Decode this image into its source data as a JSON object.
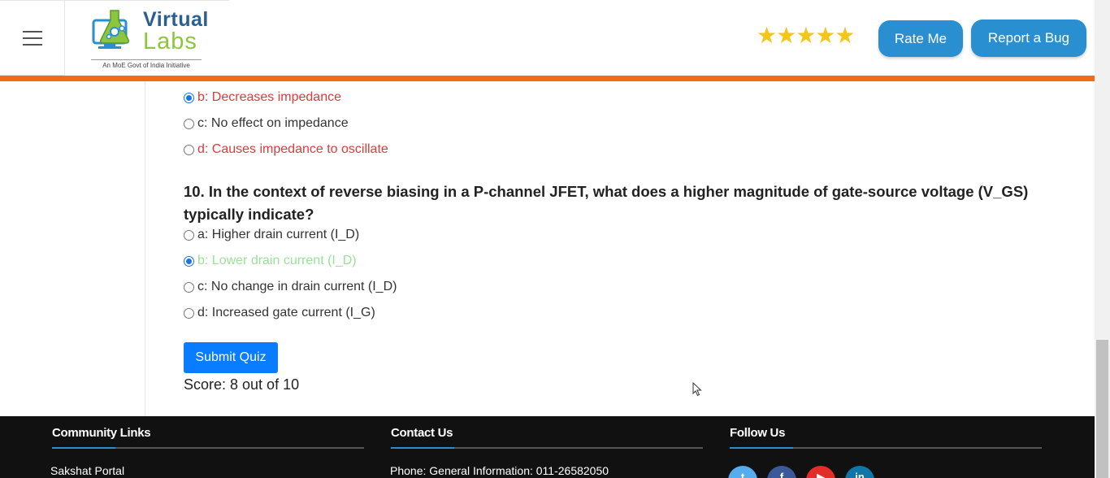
{
  "header": {
    "logo": {
      "brand_top": "Virtual",
      "brand_bottom": "Labs",
      "tagline": "An MoE Govt of India Initiative"
    },
    "rating_stars": "★★★★★",
    "rate_button": "Rate Me",
    "bug_button": "Report a Bug"
  },
  "quiz": {
    "prev_options": [
      {
        "label": "b: Decreases impedance",
        "checked": true,
        "state": "wrong"
      },
      {
        "label": "c: No effect on impedance",
        "checked": false,
        "state": "normal"
      },
      {
        "label": "d: Causes impedance to oscillate",
        "checked": false,
        "state": "wrong"
      }
    ],
    "question": "10. In the context of reverse biasing in a P-channel JFET, what does a higher magnitude of gate-source voltage (V_GS) typically indicate?",
    "options": [
      {
        "label": "a: Higher drain current (I_D)",
        "checked": false,
        "state": "normal"
      },
      {
        "label": "b: Lower drain current (I_D)",
        "checked": true,
        "state": "correct"
      },
      {
        "label": "c: No change in drain current (I_D)",
        "checked": false,
        "state": "normal"
      },
      {
        "label": "d: Increased gate current (I_G)",
        "checked": false,
        "state": "normal"
      }
    ],
    "submit_label": "Submit Quiz",
    "score": "Score: 8 out of 10"
  },
  "footer": {
    "community": {
      "title": "Community Links",
      "first_link": "Sakshat Portal"
    },
    "contact": {
      "title": "Contact Us",
      "phone": "Phone: General Information: 011-26582050"
    },
    "follow": {
      "title": "Follow Us",
      "icons": [
        "twitter-icon",
        "facebook-icon",
        "youtube-icon",
        "linkedin-icon"
      ]
    }
  },
  "colors": {
    "accent_blue": "#2a8fd1",
    "submit_blue": "#0a7cff",
    "orange_bar": "#f26b1d",
    "wrong_red": "#e03a3a",
    "correct_green": "#9be09b",
    "star_gold": "#f5c518"
  }
}
